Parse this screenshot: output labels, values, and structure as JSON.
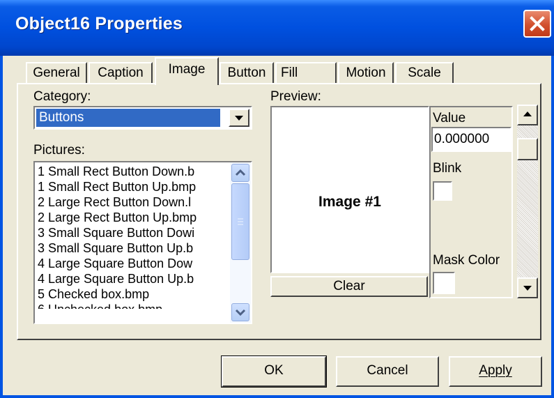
{
  "window": {
    "title": "Object16 Properties"
  },
  "tabs": [
    "General",
    "Caption",
    "Image",
    "Button",
    "Fill",
    "Motion",
    "Scale"
  ],
  "active_tab": "Image",
  "category": {
    "label": "Category:",
    "value": "Buttons"
  },
  "pictures": {
    "label": "Pictures:",
    "items": [
      "1 Small Rect Button Down.b",
      "1 Small Rect Button Up.bmp",
      "2 Large Rect Button Down.l",
      "2 Large Rect Button Up.bmp",
      "3 Small Square Button Dowi",
      "3 Small Square Button Up.b",
      "4 Large Square Button Dow",
      "4 Large Square Button Up.b",
      "5 Checked box.bmp"
    ]
  },
  "preview": {
    "label": "Preview:",
    "text": "Image #1",
    "clear_label": "Clear"
  },
  "value": {
    "label": "Value",
    "field": "0.000000"
  },
  "blink": {
    "label": "Blink"
  },
  "mask_color": {
    "label": "Mask Color"
  },
  "buttons": {
    "ok": "OK",
    "cancel": "Cancel",
    "apply": "Apply"
  },
  "colors": {
    "title_bar": "#0054E3",
    "selection": "#316AC5",
    "face": "#ECE9D8",
    "close": "#D2502E"
  }
}
